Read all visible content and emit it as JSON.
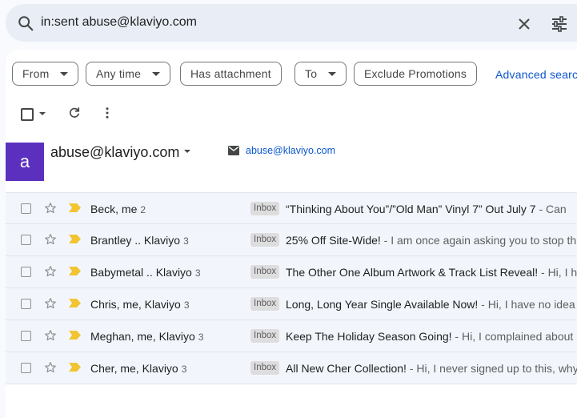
{
  "search": {
    "query": "in:sent abuse@klaviyo.com"
  },
  "filters": {
    "chips": [
      "From",
      "Any time",
      "Has attachment",
      "To",
      "Exclude Promotions"
    ],
    "advanced_label": "Advanced search"
  },
  "contact": {
    "avatar_letter": "a",
    "name": "abuse@klaviyo.com",
    "email": "abuse@klaviyo.com",
    "avatar_color": "#5b30bf"
  },
  "emails": [
    {
      "sender": "Beck, me",
      "count": "2",
      "label": "Inbox",
      "subject": "“Thinking About You”/”Old Man” Vinyl 7” Out July 7",
      "snippet": " - Can"
    },
    {
      "sender": "Brantley .. Klaviyo",
      "count": "3",
      "label": "Inbox",
      "subject": "25% Off Site-Wide!",
      "snippet": " - I am once again asking you to stop th"
    },
    {
      "sender": "Babymetal .. Klaviyo",
      "count": "3",
      "label": "Inbox",
      "subject": "The Other One Album Artwork & Track List Reveal!",
      "snippet": " - Hi, I h"
    },
    {
      "sender": "Chris, me, Klaviyo",
      "count": "3",
      "label": "Inbox",
      "subject": "Long, Long Year Single Available Now!",
      "snippet": " - Hi, I have no idea"
    },
    {
      "sender": "Meghan, me, Klaviyo",
      "count": "3",
      "label": "Inbox",
      "subject": "Keep The Holiday Season Going!",
      "snippet": " - Hi, I complained about"
    },
    {
      "sender": "Cher, me, Klaviyo",
      "count": "3",
      "label": "Inbox",
      "subject": "All New Cher Collection!",
      "snippet": " - Hi, I never signed up to this, why"
    }
  ]
}
